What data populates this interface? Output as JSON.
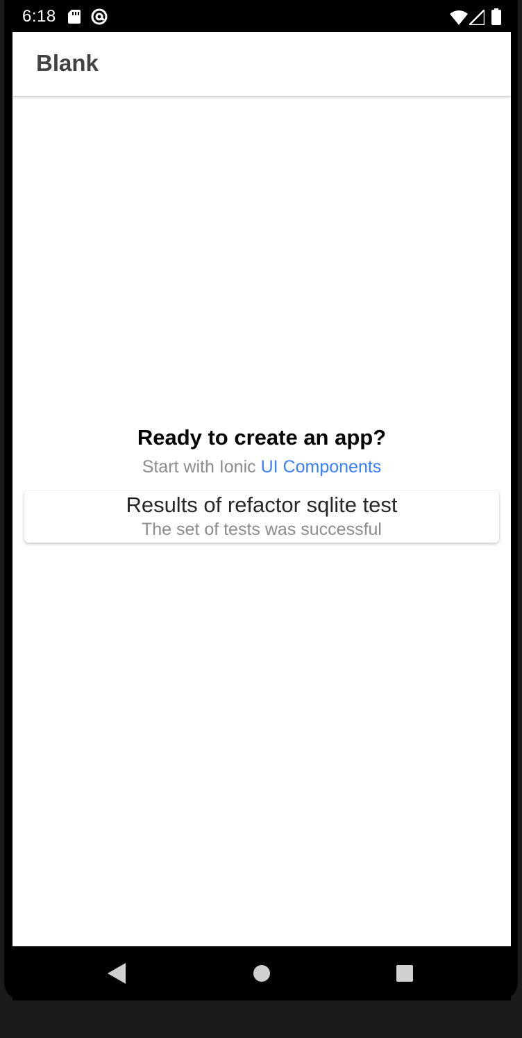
{
  "status_bar": {
    "time": "6:18",
    "icons": [
      "sd-card-icon",
      "at-sign-icon",
      "wifi-icon",
      "cell-signal-icon",
      "battery-icon"
    ]
  },
  "toolbar": {
    "title": "Blank"
  },
  "content": {
    "heading": "Ready to create an app?",
    "subline_prefix": "Start with Ionic",
    "subline_link": "UI Components",
    "link_color": "#3880ff"
  },
  "card": {
    "title": "Results of refactor sqlite test",
    "subtitle": "The set of tests was successful"
  },
  "nav_bar": {
    "buttons": [
      "back-icon",
      "home-icon",
      "recents-icon"
    ]
  }
}
